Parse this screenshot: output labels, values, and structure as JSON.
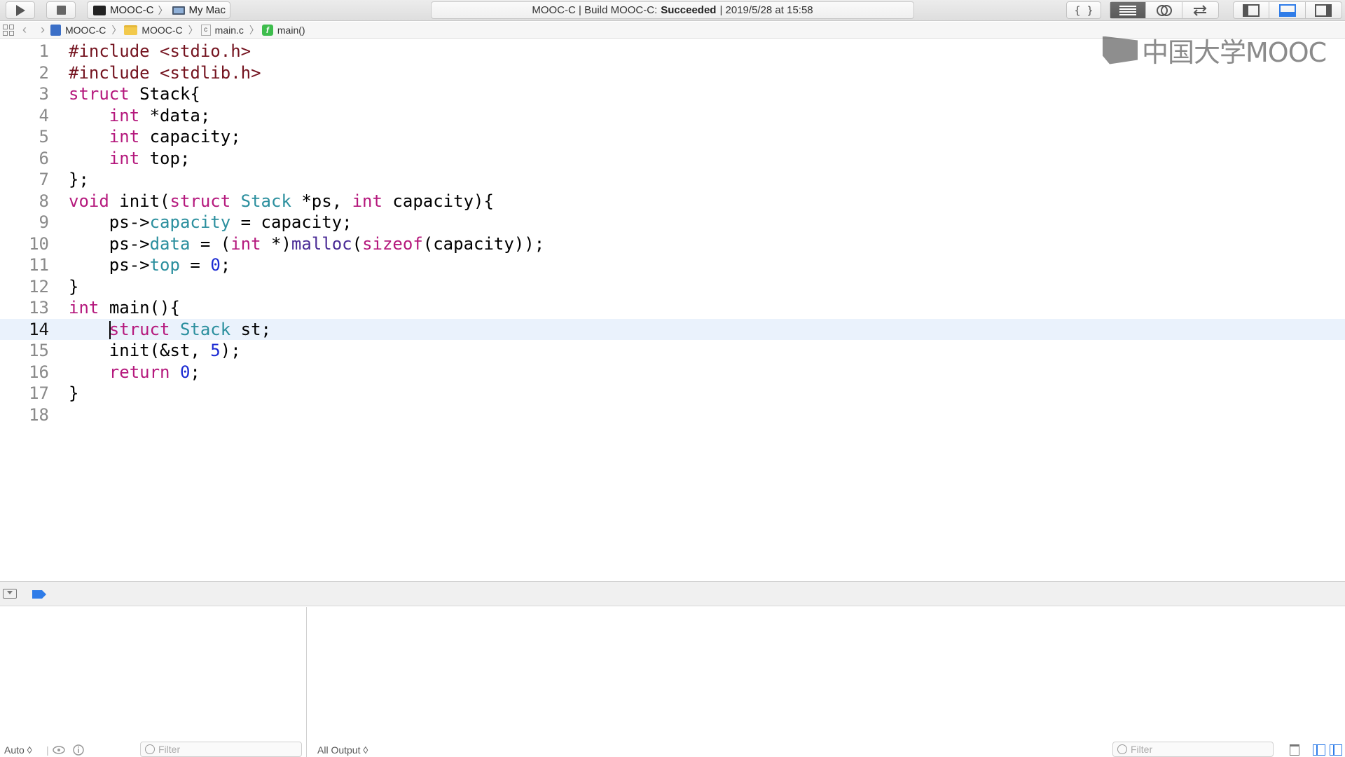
{
  "toolbar": {
    "scheme_target": "MOOC-C",
    "scheme_device": "My Mac",
    "activity_prefix": "MOOC-C | Build MOOC-C:",
    "activity_status": "Succeeded",
    "activity_suffix": "| 2019/5/28 at 15:58",
    "icons": [
      "run-icon",
      "stop-icon",
      "code-snippet-icon",
      "standard-editor-icon",
      "assistant-editor-icon",
      "version-editor-icon",
      "navigator-toggle-icon",
      "debug-toggle-icon",
      "utilities-toggle-icon"
    ]
  },
  "jumpbar": {
    "crumbs": [
      "MOOC-C",
      "MOOC-C",
      "main.c",
      "main()"
    ]
  },
  "editor": {
    "current_line": 14,
    "line_numbers": [
      "1",
      "2",
      "3",
      "4",
      "5",
      "6",
      "7",
      "8",
      "9",
      "10",
      "11",
      "12",
      "13",
      "14",
      "15",
      "16",
      "17",
      "18"
    ],
    "tokens": {
      "include": "#include",
      "stdio": "<stdio.h>",
      "stdlib": "<stdlib.h>",
      "struct": "struct",
      "stack_decl": "Stack{",
      "int": "int",
      "data_decl": "*data;",
      "capacity_decl": "capacity;",
      "top_decl": "top;",
      "close_struct": "};",
      "void": "void",
      "init_open": "init(",
      "Stack": "Stack",
      "ps_param": "*ps,",
      "capacity_param": "capacity){",
      "ps_arrow": "ps->",
      "capacity": "capacity",
      "assign_capacity": "= capacity;",
      "data": "data",
      "assign_open": "= (",
      "cast_close": "*)",
      "malloc": "malloc",
      "paren": "(",
      "sizeof": "sizeof",
      "sizeof_arg": "(capacity));",
      "top": "top",
      "assign": "=",
      "zero": "0",
      "semi": ";",
      "close_brace": "}",
      "main_open": "main(){",
      "st_decl": "st;",
      "init_call": "init(&st,",
      "five": "5",
      "call_close": ");",
      "return": "return"
    }
  },
  "watermark": {
    "text": "中国大学MOOC"
  },
  "debug": {
    "scope_label": "Auto ◊",
    "var_filter_placeholder": "Filter",
    "output_label": "All Output ◊",
    "console_filter_placeholder": "Filter"
  }
}
